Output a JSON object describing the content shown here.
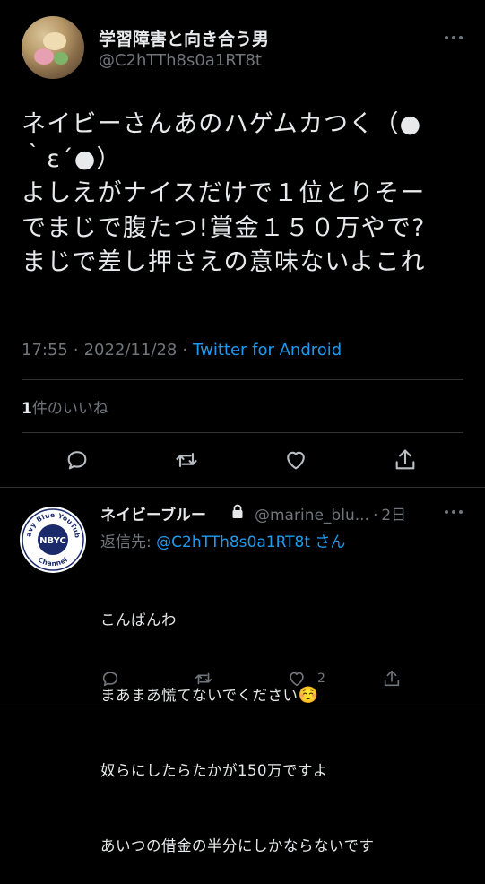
{
  "tweet": {
    "author_name": "学習障害と向き合う男",
    "author_handle": "@C2hTTh8s0a1RT8t",
    "text": "ネイビーさんあのハゲムカつく（●\n｀ε´●）\nよしえがナイスだけで１位とりそー\nでまじで腹たつ!賞金１５０万やで?\nまじで差し押さえの意味ないよこれ",
    "time": "17:55",
    "date": "2022/11/28",
    "source": "Twitter for Android",
    "likes_count": "1",
    "likes_label": "件のいいね"
  },
  "reply": {
    "author_name": "ネイビーブルー",
    "author_handle": "@marine_blu...",
    "time": "2日",
    "reply_to_label": "返信先:",
    "reply_to_handle": "@C2hTTh8s0a1RT8t",
    "reply_to_suffix": "さん",
    "text_lines": [
      "こんばんわ",
      "まあまあ慌てないでください",
      "奴らにしたらたかが150万ですよ",
      "あいつの借金の半分にしかならないです"
    ],
    "emoji": "☺️",
    "like_count": "2",
    "avatar_text": "NBYC",
    "avatar_ring_text": "Navy Blue YouTube Channel"
  },
  "icons": {
    "more": "more-horizontal-icon",
    "reply": "reply-icon",
    "retweet": "retweet-icon",
    "like": "heart-icon",
    "share": "share-icon",
    "lock": "lock-icon"
  },
  "colors": {
    "background": "#000000",
    "text": "#e7e9ea",
    "secondary": "#71767b",
    "accent": "#1d9bf0",
    "divider": "#2f3336"
  }
}
